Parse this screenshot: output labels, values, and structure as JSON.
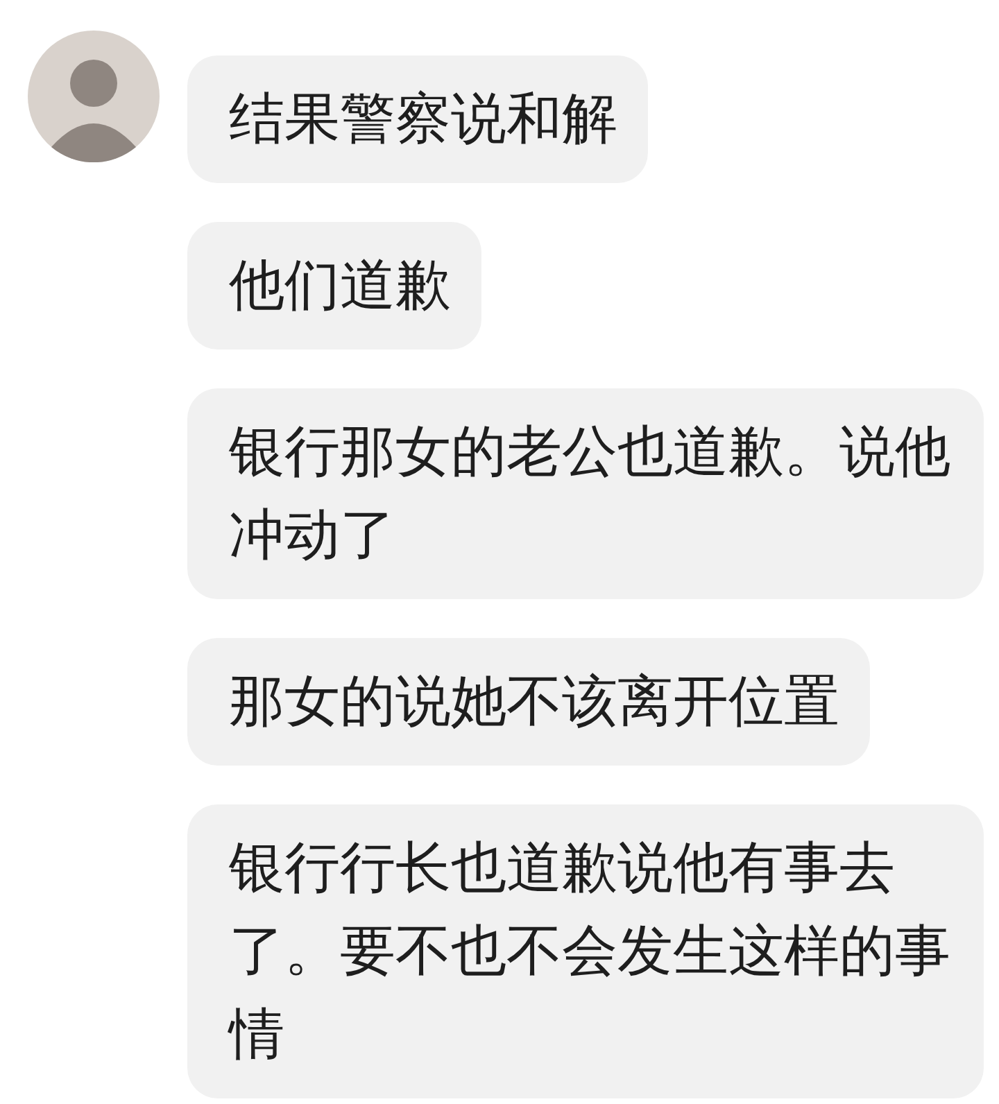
{
  "messages": [
    {
      "text": "结果警察说和解"
    },
    {
      "text": "他们道歉"
    },
    {
      "text": "银行那女的老公也道歉。说他冲动了"
    },
    {
      "text": "那女的说她不该离开位置"
    },
    {
      "text": "银行行长也道歉说他有事去了。要不也不会发生这样的事情"
    }
  ]
}
